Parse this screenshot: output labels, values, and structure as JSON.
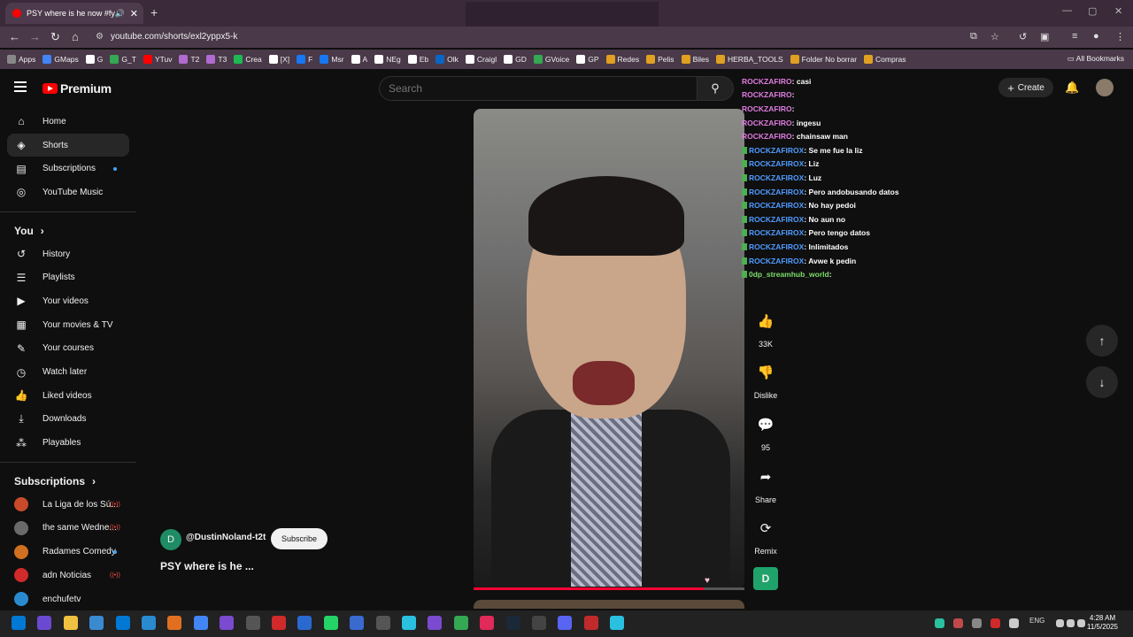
{
  "browser": {
    "tab_title": "PSY where is he now #fyp",
    "url": "youtube.com/shorts/exl2yppx5-k",
    "bookmarks": [
      "Apps",
      "GMaps",
      "G",
      "G_T",
      "YTuv",
      "T2",
      "T3",
      "Crea",
      "[X]",
      "F",
      "Msr",
      "A",
      "NEg",
      "Eb",
      "Olk",
      "Craigl",
      "GD",
      "GVoice",
      "GP",
      "Redes",
      "Pelis",
      "Biles",
      "HERBA_TOOLS",
      "Folder No borrar",
      "Compras"
    ],
    "all_bookmarks": "All Bookmarks"
  },
  "yt": {
    "logo": "Premium",
    "search_placeholder": "Search",
    "create": "Create"
  },
  "sidebar": {
    "main": [
      {
        "label": "Home",
        "icon": "home-icon"
      },
      {
        "label": "Shorts",
        "icon": "shorts-icon"
      },
      {
        "label": "Subscriptions",
        "icon": "subscriptions-icon"
      },
      {
        "label": "YouTube Music",
        "icon": "music-icon"
      }
    ],
    "you_header": "You",
    "you": [
      {
        "label": "History"
      },
      {
        "label": "Playlists"
      },
      {
        "label": "Your videos"
      },
      {
        "label": "Your movies & TV"
      },
      {
        "label": "Your courses"
      },
      {
        "label": "Watch later"
      },
      {
        "label": "Liked videos"
      },
      {
        "label": "Downloads"
      },
      {
        "label": "Playables"
      }
    ],
    "subs_header": "Subscriptions",
    "subs": [
      {
        "label": "La Liga de los Sú...",
        "color": "#c84a2a"
      },
      {
        "label": "the same Wedne...",
        "color": "#6a6a6a"
      },
      {
        "label": "Radames Comedy",
        "color": "#d07020"
      },
      {
        "label": "adn Noticias",
        "color": "#d02a2a"
      },
      {
        "label": "enchufetv",
        "color": "#2a8ad0"
      }
    ]
  },
  "video": {
    "channel": "@DustinNoland-t2t",
    "channel_initial": "D",
    "subscribe": "Subscribe",
    "title": "PSY where is he ...",
    "progress": 0.85
  },
  "actions": {
    "likes": "33K",
    "dislike": "Dislike",
    "comments": "95",
    "share": "Share",
    "remix": "Remix",
    "bot_initial": "D"
  },
  "chat": [
    {
      "user": "ROCKZAFIRO",
      "msg": ": casi",
      "style": "u"
    },
    {
      "user": "ROCKZAFIRO",
      "msg": ": ",
      "style": "u"
    },
    {
      "user": "ROCKZAFIRO",
      "msg": ": ",
      "style": "u"
    },
    {
      "user": "ROCKZAFIRO",
      "msg": ": ingesu",
      "style": "u"
    },
    {
      "user": "ROCKZAFIRO",
      "msg": ": chainsaw man",
      "style": "u"
    },
    {
      "user": "ROCKZAFIROX",
      "msg": ": Se me fue la liz",
      "style": "u2"
    },
    {
      "user": "ROCKZAFIROX",
      "msg": ": Liz",
      "style": "u2"
    },
    {
      "user": "ROCKZAFIROX",
      "msg": ": Luz",
      "style": "u2"
    },
    {
      "user": "ROCKZAFIROX",
      "msg": ": Pero andobusando datos",
      "style": "u2"
    },
    {
      "user": "ROCKZAFIROX",
      "msg": ": No hay pedoi",
      "style": "u2"
    },
    {
      "user": "ROCKZAFIROX",
      "msg": ": No aun no",
      "style": "u2"
    },
    {
      "user": "ROCKZAFIROX",
      "msg": ": Pero tengo datos",
      "style": "u2"
    },
    {
      "user": "ROCKZAFIROX",
      "msg": ": Inlimitados",
      "style": "u2"
    },
    {
      "user": "ROCKZAFIROX",
      "msg": ": Avwe k pedin",
      "style": "u2"
    },
    {
      "user": "0dp_streamhub_world",
      "msg": ": ",
      "style": "u3"
    }
  ],
  "taskbar": {
    "lang": "ENG",
    "time": "4:28 AM",
    "date": "11/5/2025"
  }
}
